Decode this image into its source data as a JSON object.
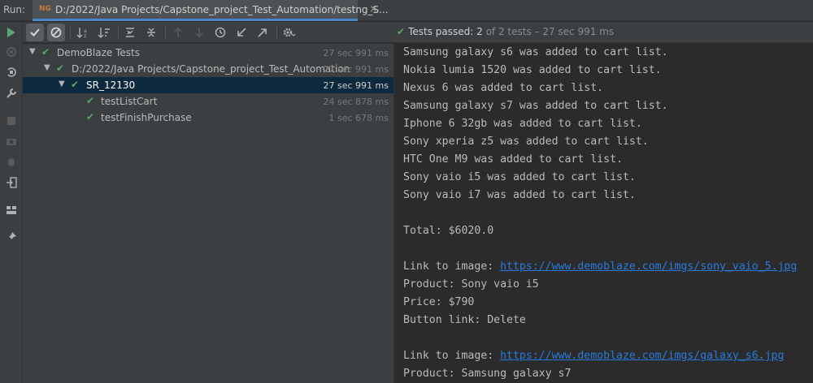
{
  "run": {
    "label": "Run:",
    "tab": {
      "icon": "testng-icon",
      "icon_text": "NG",
      "title": "D:/2022/Java Projects/Capstone_project_Test_Automation/testng_S..."
    }
  },
  "status": {
    "passed_label": "Tests passed:",
    "count": "2",
    "rest": "of 2 tests – 27 sec 991 ms"
  },
  "tree": [
    {
      "label": "DemoBlaze Tests",
      "time": "27 sec 991 ms",
      "expanded": true,
      "selected": false
    },
    {
      "label": "D:/2022/Java Projects/Capstone_project_Test_Automation",
      "time": "27 sec 991 ms",
      "expanded": true,
      "selected": false
    },
    {
      "label": "SR_12130",
      "time": "27 sec 991 ms",
      "expanded": true,
      "selected": true
    },
    {
      "label": "testListCart",
      "time": "24 sec 878 ms",
      "expanded": false,
      "selected": false
    },
    {
      "label": "testFinishPurchase",
      "time": "1 sec 678 ms",
      "expanded": false,
      "selected": false
    }
  ],
  "console": {
    "lines": [
      "Samsung galaxy s6 was added to cart list.",
      "Nokia lumia 1520 was added to cart list.",
      "Nexus 6 was added to cart list.",
      "Samsung galaxy s7 was added to cart list.",
      "Iphone 6 32gb was added to cart list.",
      "Sony xperia z5 was added to cart list.",
      "HTC One M9 was added to cart list.",
      "Sony vaio i5 was added to cart list.",
      "Sony vaio i7 was added to cart list.",
      "",
      "Total: $6020.0",
      "",
      "Link to image: ",
      "Product: Sony vaio i5",
      "Price: $790",
      "Button link: Delete",
      "",
      "Link to image: ",
      "Product: Samsung galaxy s7"
    ],
    "link1": "https://www.demoblaze.com/imgs/sony_vaio_5.jpg",
    "link2": "https://www.demoblaze.com/imgs/galaxy_s6.jpg"
  },
  "colors": {
    "pass": "#59a869",
    "link": "#287bde",
    "selection": "#0d293e",
    "accent": "#4a88c7"
  }
}
